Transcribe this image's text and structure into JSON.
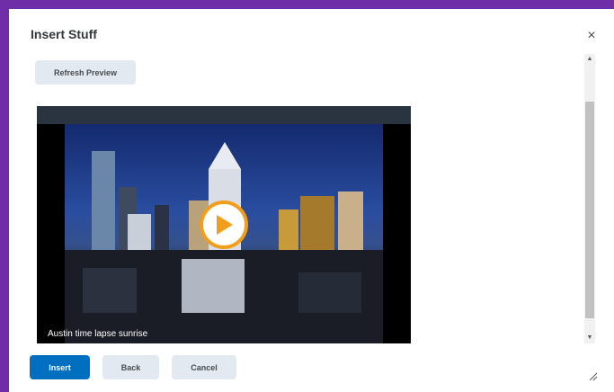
{
  "dialog": {
    "title": "Insert Stuff",
    "close_glyph": "×"
  },
  "toolbar": {
    "refresh_label": "Refresh Preview"
  },
  "video": {
    "caption": "Austin time lapse sunrise"
  },
  "footer": {
    "insert_label": "Insert",
    "back_label": "Back",
    "cancel_label": "Cancel"
  },
  "colors": {
    "accent": "#6f2da8",
    "primary_button": "#006fbf",
    "play_ring": "#f29e1d"
  },
  "icons": {
    "close": "close-icon",
    "play": "play-icon",
    "scroll_up": "arrow-up-icon",
    "scroll_down": "arrow-down-icon",
    "resize": "resize-grip-icon"
  }
}
